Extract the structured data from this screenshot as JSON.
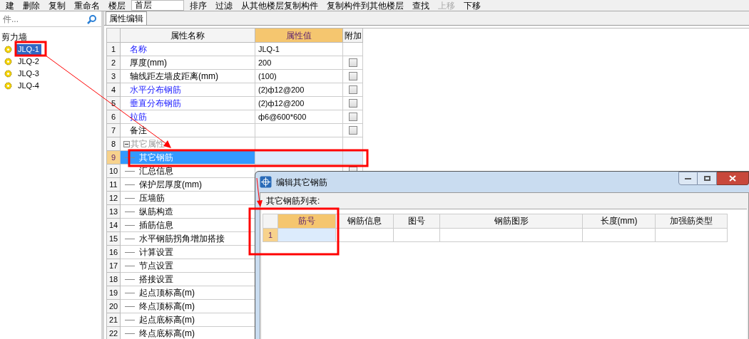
{
  "toolbar": {
    "items": [
      {
        "label": "建",
        "kind": "menu"
      },
      {
        "label": "删除",
        "kind": "button"
      },
      {
        "label": "复制",
        "kind": "button"
      },
      {
        "label": "重命名",
        "kind": "button"
      },
      {
        "label": "楼层",
        "kind": "label"
      },
      {
        "label": "首层",
        "kind": "dropdown"
      },
      {
        "label": "排序",
        "kind": "menu"
      },
      {
        "label": "过滤",
        "kind": "menu"
      },
      {
        "label": "从其他楼层复制构件",
        "kind": "button"
      },
      {
        "label": "复制构件到其他楼层",
        "kind": "button"
      },
      {
        "label": "查找",
        "kind": "menu"
      },
      {
        "label": "上移",
        "kind": "disabled"
      },
      {
        "label": "下移",
        "kind": "button"
      }
    ]
  },
  "left_panel": {
    "search": {
      "placeholder": "件..."
    },
    "tree": {
      "label": "剪力墙",
      "children": [
        {
          "label": "JLQ-1",
          "selected": true
        },
        {
          "label": "JLQ-2",
          "selected": false
        },
        {
          "label": "JLQ-3",
          "selected": false
        },
        {
          "label": "JLQ-4",
          "selected": false
        }
      ]
    }
  },
  "property_panel": {
    "tab": "属性编辑",
    "columns": [
      "属性名称",
      "属性值",
      "附加"
    ],
    "rows": [
      {
        "num": "1",
        "name": "名称",
        "value": "JLQ-1",
        "kind": "link",
        "has_checkbox": false,
        "selected": false
      },
      {
        "num": "2",
        "name": "厚度(mm)",
        "value": "200",
        "kind": "plain",
        "has_checkbox": true,
        "selected": false
      },
      {
        "num": "3",
        "name": "轴线距左墙皮距离(mm)",
        "value": "(100)",
        "kind": "plain",
        "has_checkbox": true,
        "selected": false
      },
      {
        "num": "4",
        "name": "水平分布钢筋",
        "value": "(2)ф12@200",
        "kind": "link",
        "has_checkbox": true,
        "selected": false
      },
      {
        "num": "5",
        "name": "垂直分布钢筋",
        "value": "(2)ф12@200",
        "kind": "link",
        "has_checkbox": true,
        "selected": false
      },
      {
        "num": "6",
        "name": "拉筋",
        "value": "ф6@600*600",
        "kind": "link",
        "has_checkbox": true,
        "selected": false
      },
      {
        "num": "7",
        "name": "备注",
        "kind": "plain",
        "has_checkbox": true,
        "selected": false
      },
      {
        "num": "8",
        "name": "其它属性",
        "kind": "group",
        "has_checkbox": false,
        "selected": false
      },
      {
        "num": "9",
        "name": "其它钢筋",
        "kind": "child",
        "has_checkbox": false,
        "selected": true
      },
      {
        "num": "10",
        "name": "汇总信息",
        "kind": "child",
        "has_checkbox": true,
        "selected": false
      },
      {
        "num": "11",
        "name": "保护层厚度(mm)",
        "kind": "child",
        "selected": false
      },
      {
        "num": "12",
        "name": "压墙筋",
        "kind": "child",
        "selected": false
      },
      {
        "num": "13",
        "name": "纵筋构造",
        "kind": "child",
        "selected": false
      },
      {
        "num": "14",
        "name": "插筋信息",
        "kind": "child",
        "selected": false
      },
      {
        "num": "15",
        "name": "水平钢筋拐角增加搭接",
        "kind": "child",
        "selected": false
      },
      {
        "num": "16",
        "name": "计算设置",
        "kind": "child",
        "selected": false
      },
      {
        "num": "17",
        "name": "节点设置",
        "kind": "child",
        "selected": false
      },
      {
        "num": "18",
        "name": "搭接设置",
        "kind": "child",
        "selected": false
      },
      {
        "num": "19",
        "name": "起点顶标高(m)",
        "kind": "child",
        "selected": false
      },
      {
        "num": "20",
        "name": "终点顶标高(m)",
        "kind": "child",
        "selected": false
      },
      {
        "num": "21",
        "name": "起点底标高(m)",
        "kind": "child",
        "selected": false
      },
      {
        "num": "22",
        "name": "终点底标高(m)",
        "kind": "child",
        "selected": false
      }
    ]
  },
  "dialog": {
    "title": "编辑其它钢筋",
    "list_label": "其它钢筋列表:",
    "columns": [
      {
        "label": "筋号",
        "selected": true
      },
      {
        "label": "钢筋信息",
        "selected": false
      },
      {
        "label": "图号",
        "selected": false
      },
      {
        "label": "钢筋图形",
        "selected": false
      },
      {
        "label": "长度(mm)",
        "selected": false
      },
      {
        "label": "加强筋类型",
        "selected": false
      }
    ],
    "rows": [
      {
        "num": "1"
      }
    ]
  }
}
